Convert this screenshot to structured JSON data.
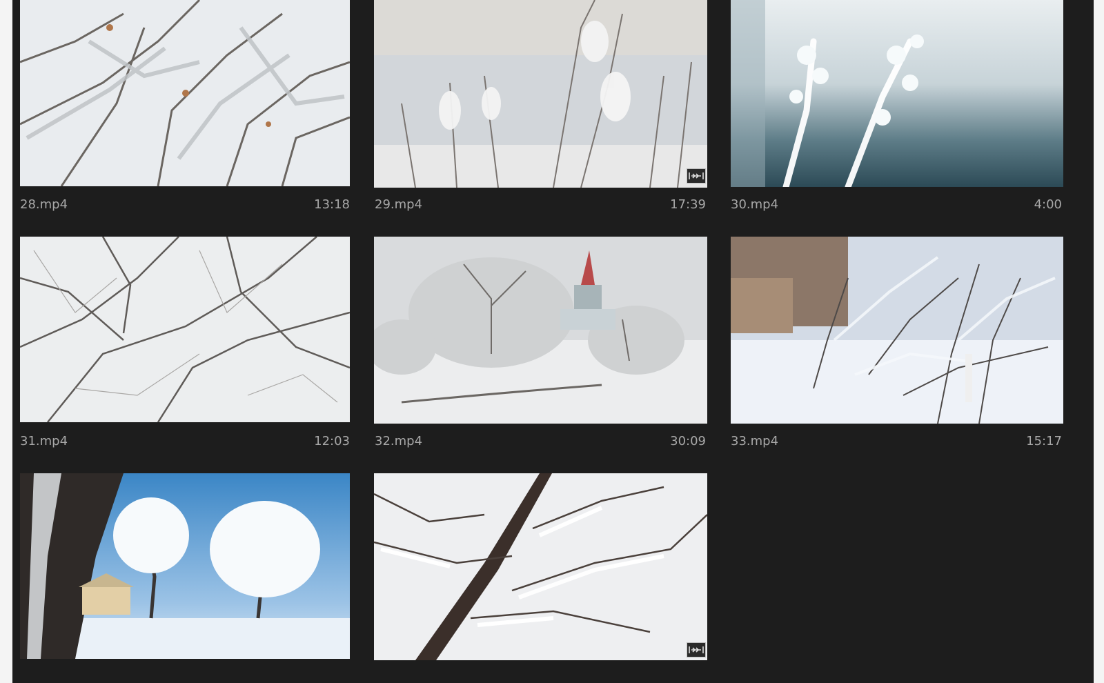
{
  "bin": {
    "clips": [
      {
        "name": "28.mp4",
        "duration": "13:18",
        "thumbnail": "frosted-branches-closeup",
        "badge": false
      },
      {
        "name": "29.mp4",
        "duration": "17:39",
        "thumbnail": "frosted-reeds-by-lake",
        "badge": true
      },
      {
        "name": "30.mp4",
        "duration": "4:00",
        "thumbnail": "frost-crystals-macro",
        "badge": false
      },
      {
        "name": "31.mp4",
        "duration": "12:03",
        "thumbnail": "frosted-tree-canopy",
        "badge": false
      },
      {
        "name": "32.mp4",
        "duration": "30:09",
        "thumbnail": "snowy-park-with-tower",
        "badge": false
      },
      {
        "name": "33.mp4",
        "duration": "15:17",
        "thumbnail": "snowy-garden-trees",
        "badge": false
      },
      {
        "name": "",
        "duration": "",
        "thumbnail": "rime-trees-blue-sky-house",
        "badge": false
      },
      {
        "name": "",
        "duration": "",
        "thumbnail": "snowy-branch-against-sky",
        "badge": true
      }
    ]
  },
  "colors": {
    "panel_bg": "#1d1d1d",
    "label_text": "#a8a8a8"
  },
  "icons": {
    "badge": "clip-speed-icon"
  }
}
